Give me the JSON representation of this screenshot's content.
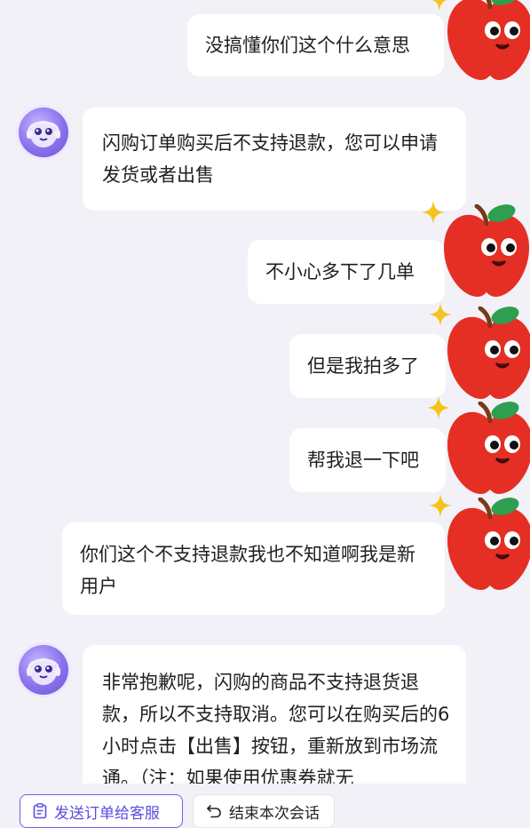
{
  "messages": [
    {
      "role": "user",
      "text": "没搞懂你们这个什么意思"
    },
    {
      "role": "bot",
      "text": "闪购订单购买后不支持退款，您可以申请发货或者出售"
    },
    {
      "role": "user",
      "text": "不小心多下了几单"
    },
    {
      "role": "user",
      "text": "但是我拍多了"
    },
    {
      "role": "user",
      "text": "帮我退一下吧"
    },
    {
      "role": "user",
      "text": "你们这个不支持退款我也不知道啊我是新用户"
    },
    {
      "role": "bot",
      "text": "非常抱歉呢，闪购的商品不支持退货退款，所以不支持取消。您可以在购买后的6小时点击【出售】按钮，重新放到市场流通。（注：如果使用优惠券就无"
    }
  ],
  "actions": {
    "send_order_label": "发送订单给客服",
    "end_session_label": "结束本次会话"
  },
  "icons": {
    "user_avatar": "apple-mascot-icon",
    "bot_avatar": "assistant-avatar-icon",
    "sparkle": "sparkle-icon",
    "send_order": "clipboard-icon",
    "end_session": "return-arrow-icon"
  },
  "colors": {
    "background": "#f2f1f8",
    "bubble": "#ffffff",
    "accent": "#5a4de0",
    "apple_red": "#e52f24",
    "leaf_green": "#2e9e4f",
    "sparkle_yellow": "#f6c21c"
  }
}
